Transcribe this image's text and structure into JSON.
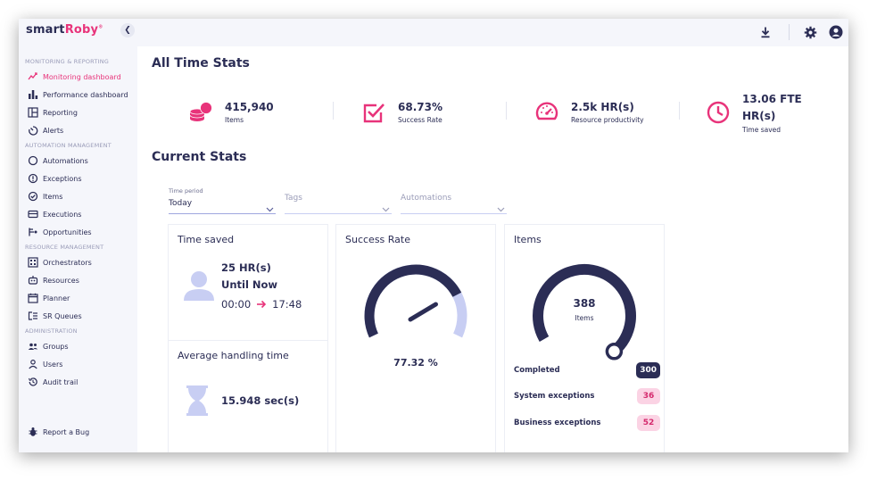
{
  "app": {
    "logo_main": "smart",
    "logo_accent": "Roby",
    "logo_mark": "®"
  },
  "colors": {
    "accent": "#e8337a",
    "navy": "#2b2d55",
    "light_blue": "#c8cef3",
    "sidebar_bg": "#f5f6fb"
  },
  "sidebar": {
    "sections": [
      {
        "title": "MONITORING & REPORTING",
        "items": [
          {
            "label": "Monitoring dashboard",
            "icon": "trend-icon",
            "active": true
          },
          {
            "label": "Performance dashboard",
            "icon": "bar-chart-icon"
          },
          {
            "label": "Reporting",
            "icon": "layout-icon"
          },
          {
            "label": "Alerts",
            "icon": "alert-icon"
          }
        ]
      },
      {
        "title": "AUTOMATION MANAGEMENT",
        "items": [
          {
            "label": "Automations",
            "icon": "circle-icon"
          },
          {
            "label": "Exceptions",
            "icon": "exclamation-icon"
          },
          {
            "label": "Items",
            "icon": "check-circle-icon"
          },
          {
            "label": "Executions",
            "icon": "card-icon"
          },
          {
            "label": "Opportunities",
            "icon": "branch-icon"
          }
        ]
      },
      {
        "title": "RESOURCE MANAGEMENT",
        "items": [
          {
            "label": "Orchestrators",
            "icon": "grid-icon"
          },
          {
            "label": "Resources",
            "icon": "robot-icon"
          },
          {
            "label": "Planner",
            "icon": "calendar-icon"
          },
          {
            "label": "SR Queues",
            "icon": "queue-icon"
          }
        ]
      },
      {
        "title": "ADMINISTRATION",
        "items": [
          {
            "label": "Groups",
            "icon": "group-icon"
          },
          {
            "label": "Users",
            "icon": "user-icon"
          },
          {
            "label": "Audit trail",
            "icon": "history-icon"
          }
        ]
      }
    ],
    "report_bug": "Report a Bug"
  },
  "all_time": {
    "title": "All Time Stats",
    "stats": [
      {
        "value": "415,940",
        "label": "Items",
        "icon": "coins-icon"
      },
      {
        "value": "68.73%",
        "label": "Success Rate",
        "icon": "checkbox-icon"
      },
      {
        "value": "2.5k HR(s)",
        "label": "Resource productivity",
        "icon": "speedometer-icon"
      },
      {
        "value": "13.06 FTE",
        "value2": "HR(s)",
        "label": "Time saved",
        "icon": "clock-icon"
      }
    ]
  },
  "current": {
    "title": "Current Stats",
    "filters": {
      "time_label": "Time period",
      "time_value": "Today",
      "tags_placeholder": "Tags",
      "automations_placeholder": "Automations"
    },
    "time_saved": {
      "title": "Time saved",
      "hours": "25 HR(s)",
      "until": "Until Now",
      "start": "00:00",
      "end": "17:48"
    },
    "aht": {
      "title": "Average handling time",
      "value": "15.948 sec(s)"
    },
    "success": {
      "title": "Success Rate",
      "value": "77.32 %",
      "fraction": 0.7732
    },
    "items": {
      "title": "Items",
      "total": "388",
      "total_label": "Items",
      "rows": [
        {
          "label": "Completed",
          "value": "300",
          "style": "dark"
        },
        {
          "label": "System exceptions",
          "value": "36",
          "style": "pink"
        },
        {
          "label": "Business exceptions",
          "value": "52",
          "style": "pink"
        }
      ]
    }
  }
}
